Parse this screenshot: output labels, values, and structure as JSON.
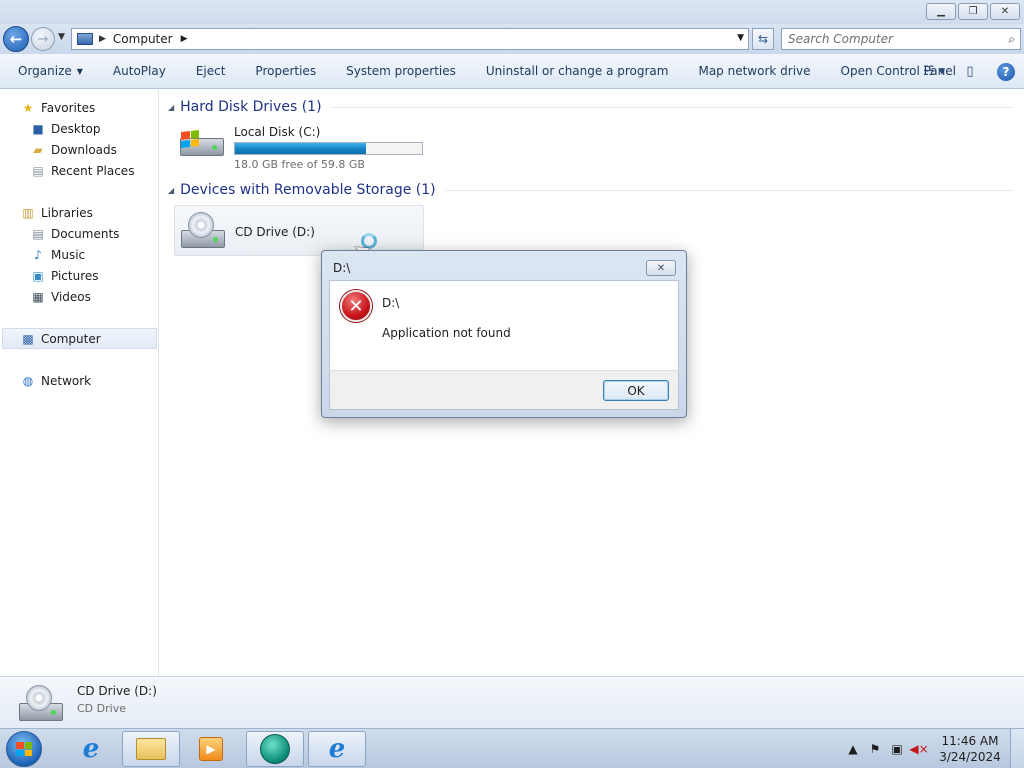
{
  "window": {
    "minimize_icon": "minimize-icon",
    "maximize_icon": "restore-icon",
    "close_icon": "close-icon"
  },
  "address_bar": {
    "path": "Computer",
    "search_placeholder": "Search Computer"
  },
  "toolbar": {
    "organize": "Organize",
    "autoplay": "AutoPlay",
    "eject": "Eject",
    "properties": "Properties",
    "system_properties": "System properties",
    "uninstall": "Uninstall or change a program",
    "map_drive": "Map network drive",
    "control_panel": "Open Control Panel"
  },
  "navpane": {
    "favorites": "Favorites",
    "desktop": "Desktop",
    "downloads": "Downloads",
    "recent_places": "Recent Places",
    "libraries": "Libraries",
    "documents": "Documents",
    "music": "Music",
    "pictures": "Pictures",
    "videos": "Videos",
    "computer": "Computer",
    "network": "Network"
  },
  "content": {
    "hdd_group": "Hard Disk Drives (1)",
    "local_disk": {
      "name": "Local Disk (C:)",
      "free_text": "18.0 GB free of 59.8 GB",
      "used_fraction": 0.699
    },
    "removable_group": "Devices with Removable Storage (1)",
    "cd_drive": {
      "name": "CD Drive (D:)"
    }
  },
  "details": {
    "name": "CD Drive (D:)",
    "type": "CD Drive"
  },
  "dialog": {
    "title": "D:\\",
    "path": "D:\\",
    "message": "Application not found",
    "ok_label": "OK"
  },
  "taskbar": {
    "time": "11:46 AM",
    "date": "3/24/2024"
  },
  "colors": {
    "usage_bar": "#1383c6",
    "group_header": "#1e3287",
    "error_red": "#c8141b"
  }
}
